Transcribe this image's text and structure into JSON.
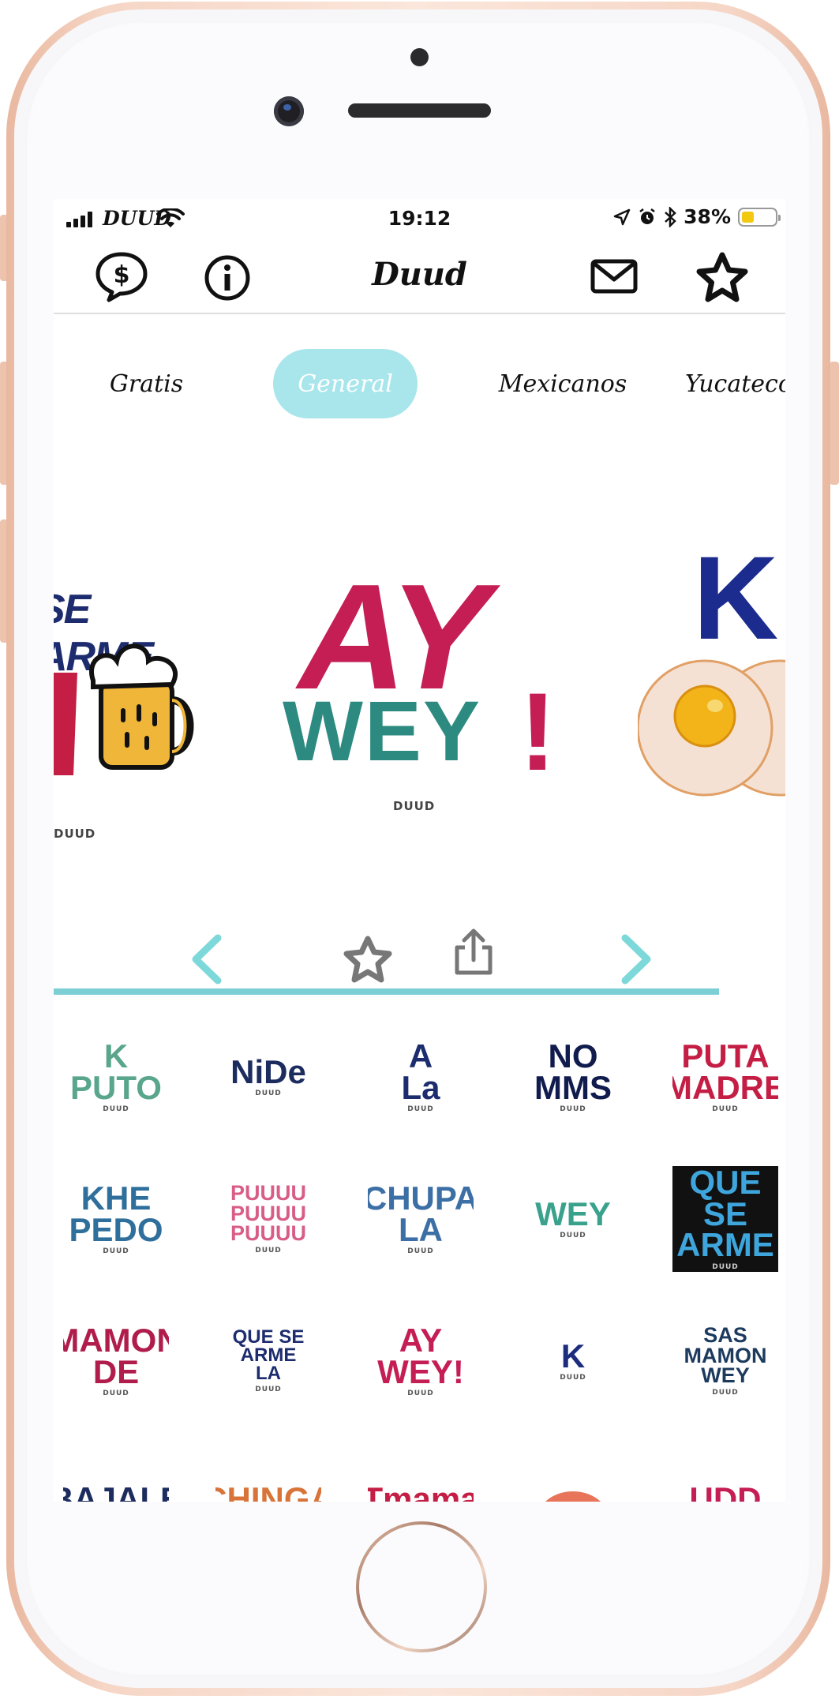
{
  "status": {
    "carrier": "DUUD",
    "time": "19:12",
    "battery_text": "38%",
    "battery_level": 0.38
  },
  "nav": {
    "title": "Duud"
  },
  "tabs": [
    {
      "label": "Gratis",
      "active": false
    },
    {
      "label": "General",
      "active": true
    },
    {
      "label": "Mexicanos",
      "active": false
    },
    {
      "label": "Yucatecos",
      "active": false
    }
  ],
  "carousel": {
    "left_text": "SE ARME",
    "main_line1": "AY",
    "main_line2": "WEY",
    "main_bang": "!",
    "right_text": "K",
    "watermark": "DUUD"
  },
  "stickers": [
    {
      "text": "K\nPUTO",
      "color": "#5aa68c",
      "color2": "#d67a96"
    },
    {
      "text": "NiDe",
      "color": "#1c2c5e",
      "color2": "#c21f53"
    },
    {
      "text": "A\nLa",
      "color": "#1c2c6e",
      "color2": "#6b3f15"
    },
    {
      "text": "NO\nMMS",
      "color": "#101b4e",
      "color2": "#2d7a7a"
    },
    {
      "text": "PUTA\nMADRE",
      "color": "#c41e45",
      "color2": "#2a6e5a"
    },
    {
      "text": "KHE\nPEDO",
      "color": "#2f6f9b",
      "color2": "#7fb1d4"
    },
    {
      "text": "PUUUU\nPUUUU\nPUUUU",
      "color": "#d85d87",
      "color2": "#c44b75"
    },
    {
      "text": "CHUPA\nLA",
      "color": "#3c6fa5",
      "color2": "#2a8a48"
    },
    {
      "text": "WEY",
      "color": "#3aa28c",
      "color2": "#1c2c5e"
    },
    {
      "text": "QUE SE\nARME",
      "color": "#3ea6dc",
      "color2": "#111111"
    },
    {
      "text": "MAMON\nDE",
      "color": "#b01d4c",
      "color2": "#1f6a5a"
    },
    {
      "text": "QUE SE ARME\nLA",
      "color": "#1c2c6e",
      "color2": "#c41e45"
    },
    {
      "text": "AY\nWEY!",
      "color": "#c41e55",
      "color2": "#2d8a80"
    },
    {
      "text": "K",
      "color": "#1c2c7e",
      "color2": "#f2b418"
    },
    {
      "text": "SAS\nMAMON\nWEY",
      "color": "#1c3a5e",
      "color2": "#2d8a80"
    },
    {
      "text": "BAJALE",
      "color": "#1c2c5e",
      "color2": "#1c2c5e"
    },
    {
      "text": "CHINGA",
      "color": "#d8743a",
      "color2": "#d8743a"
    },
    {
      "text": "Tmama",
      "color": "#c41e45",
      "color2": "#2f6f9b"
    },
    {
      "text": "",
      "color": "#e8755a",
      "color2": "#4a9a3c"
    },
    {
      "text": "UDD",
      "color": "#c41e55",
      "color2": "#c41e55"
    }
  ],
  "sticker_watermark": "DUUD",
  "colors": {
    "accent": "#7dcfd6",
    "tab_active_bg": "#a8e6ec"
  }
}
